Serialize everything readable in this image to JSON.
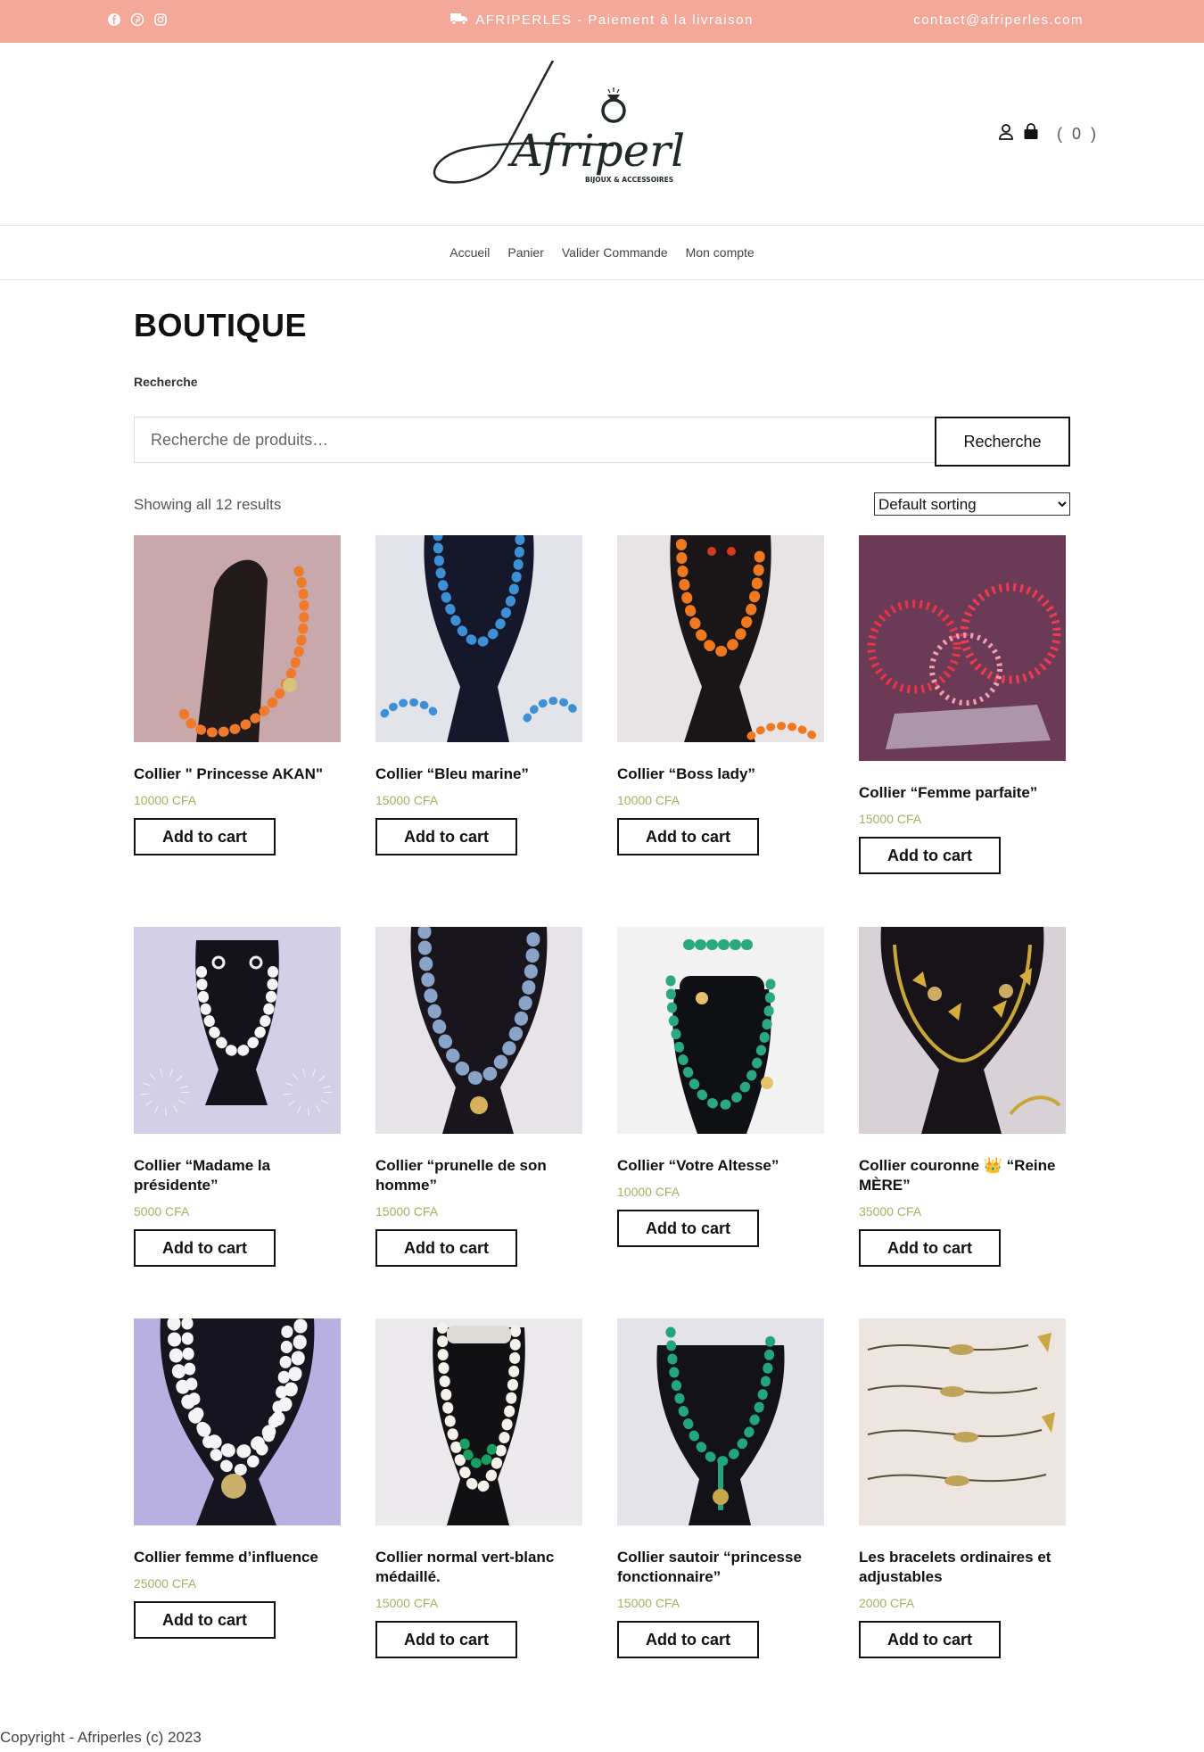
{
  "topbar": {
    "promo": "AFRIPERLES - Paiement à la livraison",
    "contact": "contact@afriperles.com",
    "social_icons": [
      "facebook-icon",
      "pinterest-icon",
      "instagram-icon"
    ],
    "background": "#f4a89a"
  },
  "header": {
    "logo_text": "Afriperles",
    "logo_subtitle": "BIJOUX & ACCESSOIRES",
    "cart_count": "( 0 )"
  },
  "nav": {
    "items": [
      "Accueil",
      "Panier",
      "Valider Commande",
      "Mon compte"
    ]
  },
  "page": {
    "title": "BOUTIQUE",
    "search_label": "Recherche",
    "search_placeholder": "Recherche de produits…",
    "search_button": "Recherche",
    "results_count": "Showing all 12 results",
    "sort_selected": "Default sorting"
  },
  "products": [
    {
      "title": "Collier \" Princesse AKAN\"",
      "price": "10000 CFA",
      "button": "Add to cart"
    },
    {
      "title": "Collier “Bleu marine”",
      "price": "15000 CFA",
      "button": "Add to cart"
    },
    {
      "title": "Collier “Boss lady”",
      "price": "10000 CFA",
      "button": "Add to cart"
    },
    {
      "title": "Collier “Femme parfaite”",
      "price": "15000 CFA",
      "button": "Add to cart"
    },
    {
      "title": "Collier “Madame la présidente”",
      "price": "5000 CFA",
      "button": "Add to cart"
    },
    {
      "title": "Collier “prunelle de son homme”",
      "price": "15000 CFA",
      "button": "Add to cart"
    },
    {
      "title": "Collier “Votre Altesse”",
      "price": "10000 CFA",
      "button": "Add to cart"
    },
    {
      "title": "Collier couronne 👑 “Reine MÈRE”",
      "price": "35000 CFA",
      "button": "Add to cart"
    },
    {
      "title": "Collier femme d’influence",
      "price": "25000 CFA",
      "button": "Add to cart"
    },
    {
      "title": "Collier normal vert-blanc médaillé.",
      "price": "15000 CFA",
      "button": "Add to cart"
    },
    {
      "title": "Collier sautoir “princesse fonctionnaire”",
      "price": "15000 CFA",
      "button": "Add to cart"
    },
    {
      "title": "Les bracelets ordinaires et adjustables",
      "price": "2000 CFA",
      "button": "Add to cart"
    }
  ],
  "footer": {
    "copyright": "Copyright - Afriperles (c) 2023"
  }
}
